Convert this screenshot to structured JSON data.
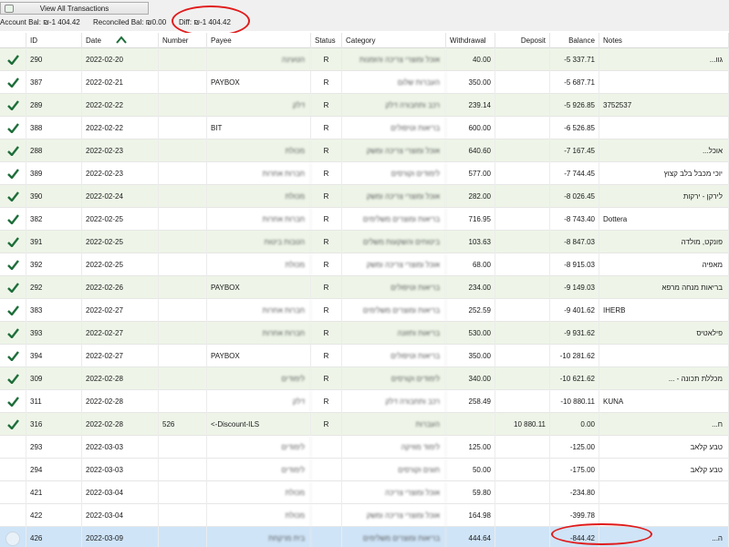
{
  "toolbar": {
    "view_all_label": "View All Transactions"
  },
  "summary": {
    "account_bal": "Account Bal: ₪-1 404.42",
    "reconciled_bal": "Reconciled Bal: ₪0.00",
    "diff": "Diff: ₪-1 404.42"
  },
  "columns": [
    "",
    "ID",
    "Date",
    "Number",
    "Payee",
    "Status",
    "Category",
    "Withdrawal",
    "Deposit",
    "Balance",
    "Notes"
  ],
  "colors": {
    "annotation": "#e01b1b",
    "check": "#1e6e3a",
    "reconciled_row": "#eef5e8",
    "selected_row": "#cfe4f7"
  },
  "rows": [
    {
      "ok": true,
      "id": "290",
      "date": "2022-02-20",
      "number": "",
      "payee": "הטעינה",
      "status": "R",
      "category": "אוכל ומוצרי צריכה והזמנות",
      "withdrawal": "40.00",
      "deposit": "",
      "balance": "-5 337.71",
      "notes": "גוו..."
    },
    {
      "ok": true,
      "id": "387",
      "date": "2022-02-21",
      "number": "",
      "payee": "PAYBOX",
      "status": "R",
      "category": "העברות שלום",
      "withdrawal": "350.00",
      "deposit": "",
      "balance": "-5 687.71",
      "notes": ""
    },
    {
      "ok": true,
      "id": "289",
      "date": "2022-02-22",
      "number": "",
      "payee": "דלק",
      "status": "R",
      "category": "רכב ותחבורה דלק",
      "withdrawal": "239.14",
      "deposit": "",
      "balance": "-5 926.85",
      "notes": "3752537"
    },
    {
      "ok": true,
      "id": "388",
      "date": "2022-02-22",
      "number": "",
      "payee": "BIT",
      "status": "R",
      "category": "בריאות וטיפולים",
      "withdrawal": "600.00",
      "deposit": "",
      "balance": "-6 526.85",
      "notes": ""
    },
    {
      "ok": true,
      "id": "288",
      "date": "2022-02-23",
      "number": "",
      "payee": "מכולת",
      "status": "R",
      "category": "אוכל ומוצרי צריכה ומשק",
      "withdrawal": "640.60",
      "deposit": "",
      "balance": "-7 167.45",
      "notes": "אוכל..."
    },
    {
      "ok": true,
      "id": "389",
      "date": "2022-02-23",
      "number": "",
      "payee": "חברות אחרות",
      "status": "R",
      "category": "לימודים וקורסים",
      "withdrawal": "577.00",
      "deposit": "",
      "balance": "-7 744.45",
      "notes": "יוכי מכבל בלב קצוץ"
    },
    {
      "ok": true,
      "id": "390",
      "date": "2022-02-24",
      "number": "",
      "payee": "מכולת",
      "status": "R",
      "category": "אוכל ומוצרי צריכה ומשק",
      "withdrawal": "282.00",
      "deposit": "",
      "balance": "-8 026.45",
      "notes": "לירקן - ירקות"
    },
    {
      "ok": true,
      "id": "382",
      "date": "2022-02-25",
      "number": "",
      "payee": "חברות אחרות",
      "status": "R",
      "category": "בריאות ומוצרים משלימים",
      "withdrawal": "716.95",
      "deposit": "",
      "balance": "-8 743.40",
      "notes": "Dottera"
    },
    {
      "ok": true,
      "id": "391",
      "date": "2022-02-25",
      "number": "",
      "payee": "הטבות ביטוח",
      "status": "R",
      "category": "ביטוחים והשקעות משלים",
      "withdrawal": "103.63",
      "deposit": "",
      "balance": "-8 847.03",
      "notes": "פונקט, מולדה"
    },
    {
      "ok": true,
      "id": "392",
      "date": "2022-02-25",
      "number": "",
      "payee": "מכולת",
      "status": "R",
      "category": "אוכל ומוצרי צריכה ומשק",
      "withdrawal": "68.00",
      "deposit": "",
      "balance": "-8 915.03",
      "notes": "מאפיה"
    },
    {
      "ok": true,
      "id": "292",
      "date": "2022-02-26",
      "number": "",
      "payee": "PAYBOX",
      "status": "R",
      "category": "בריאות וטיפולים",
      "withdrawal": "234.00",
      "deposit": "",
      "balance": "-9 149.03",
      "notes": "בריאות מנחה מרפא"
    },
    {
      "ok": true,
      "id": "383",
      "date": "2022-02-27",
      "number": "",
      "payee": "חברות אחרות",
      "status": "R",
      "category": "בריאות ומוצרים משלימים",
      "withdrawal": "252.59",
      "deposit": "",
      "balance": "-9 401.62",
      "notes": "IHERB"
    },
    {
      "ok": true,
      "id": "393",
      "date": "2022-02-27",
      "number": "",
      "payee": "חברות אחרות",
      "status": "R",
      "category": "בריאות ותזונה",
      "withdrawal": "530.00",
      "deposit": "",
      "balance": "-9 931.62",
      "notes": "פילאטיס"
    },
    {
      "ok": true,
      "id": "394",
      "date": "2022-02-27",
      "number": "",
      "payee": "PAYBOX",
      "status": "R",
      "category": "בריאות וטיפולים",
      "withdrawal": "350.00",
      "deposit": "",
      "balance": "-10 281.62",
      "notes": ""
    },
    {
      "ok": true,
      "id": "309",
      "date": "2022-02-28",
      "number": "",
      "payee": "לימודים",
      "status": "R",
      "category": "לימודים וקורסים",
      "withdrawal": "340.00",
      "deposit": "",
      "balance": "-10 621.62",
      "notes": "מכללת תכונה - ..."
    },
    {
      "ok": true,
      "id": "311",
      "date": "2022-02-28",
      "number": "",
      "payee": "דלק",
      "status": "R",
      "category": "רכב ותחבורה דלק",
      "withdrawal": "258.49",
      "deposit": "",
      "balance": "-10 880.11",
      "notes": "KUNA"
    },
    {
      "ok": true,
      "id": "316",
      "date": "2022-02-28",
      "number": "526",
      "payee": "<-Discount-ILS",
      "status": "R",
      "category": "העברות",
      "withdrawal": "",
      "deposit": "10 880.11",
      "balance": "0.00",
      "notes": "ח..."
    },
    {
      "ok": false,
      "id": "293",
      "date": "2022-03-03",
      "number": "",
      "payee": "לימודים",
      "status": "",
      "category": "לימוד מוזיקה",
      "withdrawal": "125.00",
      "deposit": "",
      "balance": "-125.00",
      "notes": "טבע קלאב"
    },
    {
      "ok": false,
      "id": "294",
      "date": "2022-03-03",
      "number": "",
      "payee": "לימודים",
      "status": "",
      "category": "חוגים וקורסים",
      "withdrawal": "50.00",
      "deposit": "",
      "balance": "-175.00",
      "notes": "טבע קלאב"
    },
    {
      "ok": false,
      "id": "421",
      "date": "2022-03-04",
      "number": "",
      "payee": "מכולת",
      "status": "",
      "category": "אוכל ומוצרי צריכה",
      "withdrawal": "59.80",
      "deposit": "",
      "balance": "-234.80",
      "notes": ""
    },
    {
      "ok": false,
      "id": "422",
      "date": "2022-03-04",
      "number": "",
      "payee": "מכולת",
      "status": "",
      "category": "אוכל ומוצרי צריכה ומשק",
      "withdrawal": "164.98",
      "deposit": "",
      "balance": "-399.78",
      "notes": ""
    },
    {
      "ok": false,
      "selected": true,
      "id": "426",
      "date": "2022-03-09",
      "number": "",
      "payee": "בית מרקחת",
      "status": "",
      "category": "בריאות ומוצרים משלימים",
      "withdrawal": "444.64",
      "deposit": "",
      "balance": "-844.42",
      "notes": "ה..."
    }
  ]
}
